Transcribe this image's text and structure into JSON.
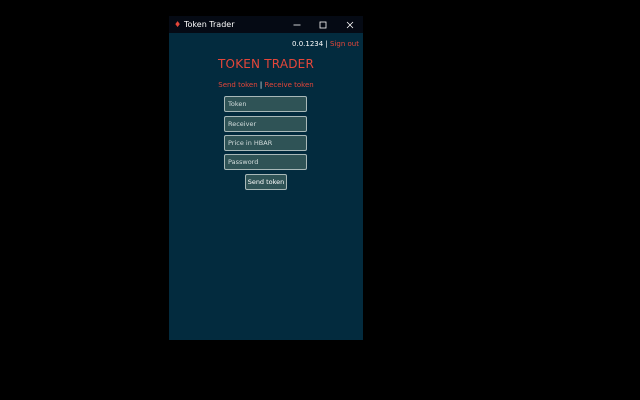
{
  "window": {
    "title": "Token Trader",
    "controls": {
      "minimize": "minimize-icon",
      "maximize": "maximize-icon",
      "close": "close-icon"
    }
  },
  "account": {
    "id": "0.0.1234",
    "separator": "|",
    "sign_out": "Sign out"
  },
  "app": {
    "heading": "TOKEN TRADER"
  },
  "nav": {
    "send": "Send token",
    "separator": "|",
    "receive": "Receive token"
  },
  "form": {
    "token_placeholder": "Token",
    "receiver_placeholder": "Receiver",
    "price_placeholder": "Price in HBAR",
    "password_placeholder": "Password",
    "submit_label": "Send token"
  },
  "colors": {
    "accent": "#e5463a",
    "background": "#032b3e",
    "titlebar": "#050a14",
    "field": "#2f5356"
  }
}
